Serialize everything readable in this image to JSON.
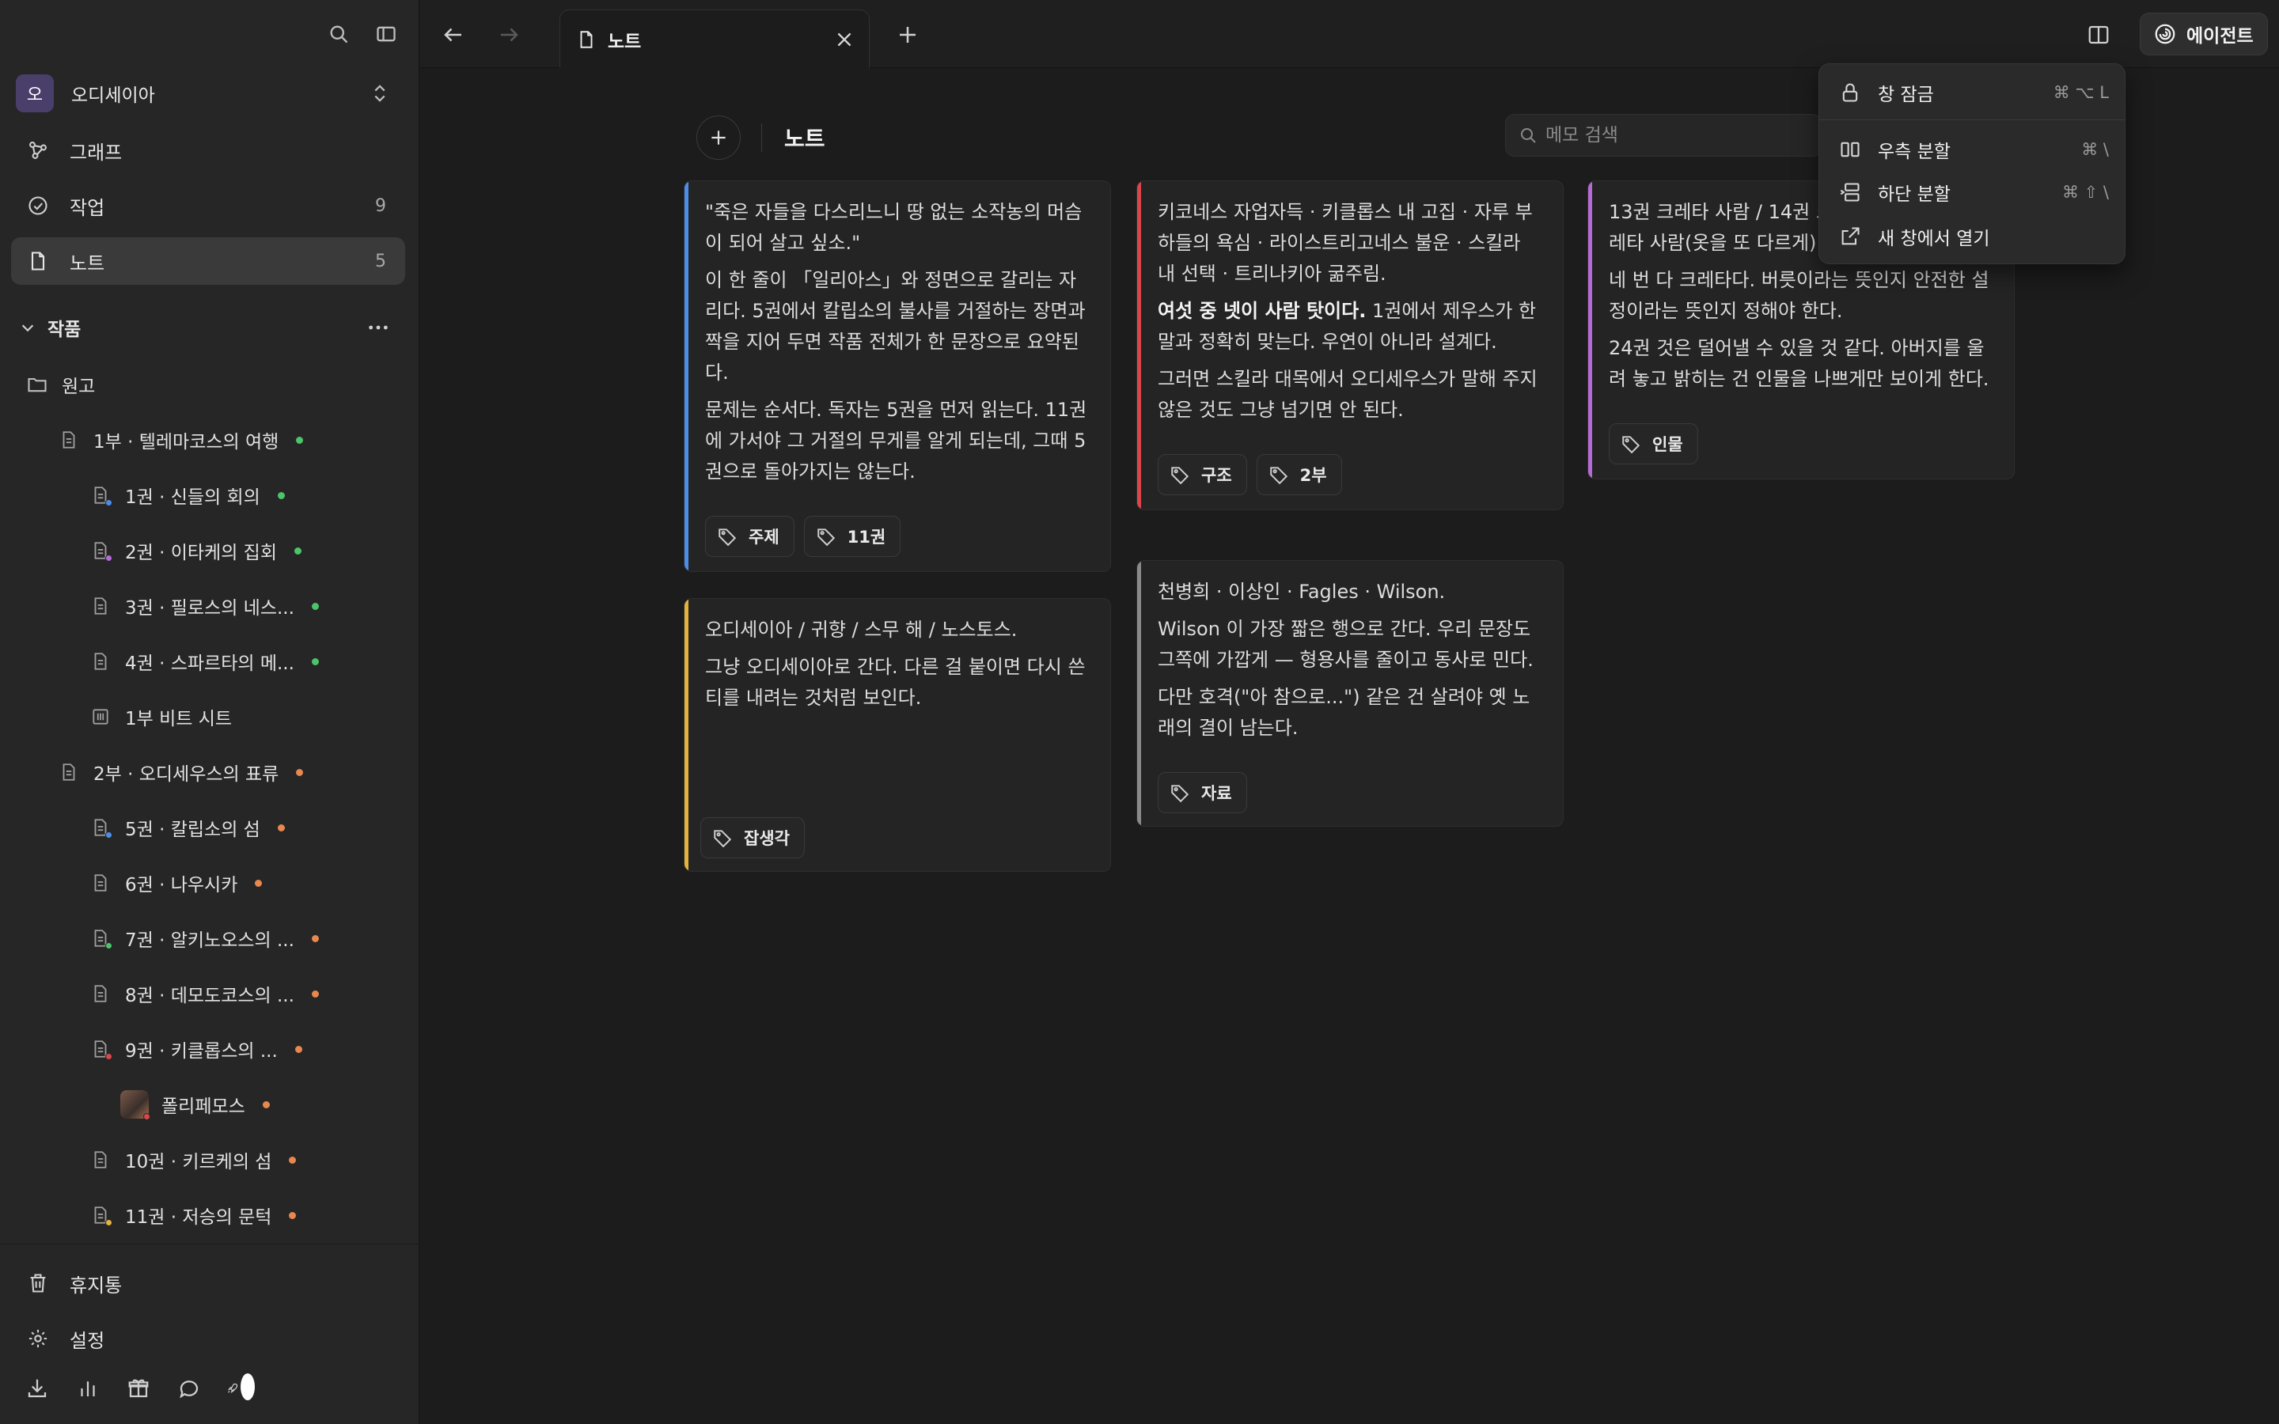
{
  "sidebar": {
    "workspace": {
      "avatar_letter": "오",
      "name": "오디세이아"
    },
    "nav": [
      {
        "label": "그래프",
        "count": ""
      },
      {
        "label": "작업",
        "count": "9"
      },
      {
        "label": "노트",
        "count": "5"
      }
    ],
    "section": {
      "label": "작품"
    },
    "tree": [
      {
        "label": "원고"
      },
      {
        "label": "1부 · 텔레마코스의 여행"
      },
      {
        "label": "1권 · 신들의 회의"
      },
      {
        "label": "2권 · 이타케의 집회"
      },
      {
        "label": "3권 · 필로스의 네스..."
      },
      {
        "label": "4권 · 스파르타의 메..."
      },
      {
        "label": "1부 비트 시트"
      },
      {
        "label": "2부 · 오디세우스의 표류"
      },
      {
        "label": "5권 · 칼립소의 섬"
      },
      {
        "label": "6권 · 나우시카"
      },
      {
        "label": "7권 · 알키노오스의 ..."
      },
      {
        "label": "8권 · 데모도코스의 ..."
      },
      {
        "label": "9권 · 키클롭스의 ..."
      },
      {
        "label": "폴리페모스"
      },
      {
        "label": "10권 · 키르케의 섬"
      },
      {
        "label": "11권 · 저승의 문턱"
      }
    ],
    "bottom": [
      {
        "label": "휴지통"
      },
      {
        "label": "설정"
      }
    ],
    "colors": {
      "green": "#4cc46a",
      "orange": "#e8874e",
      "blue": "#4c8de8",
      "purple": "#b56ad6",
      "red": "#d9464b",
      "yellow": "#e3b33d"
    }
  },
  "topbar": {
    "tab_label": "노트",
    "agent_label": "에이전트"
  },
  "main": {
    "title": "노트",
    "search_placeholder": "메모 검색",
    "cards": [
      {
        "accent": "#4c8de8",
        "paragraphs": [
          "\"죽은 자들을 다스리느니 땅 없는 소작농의 머슴이 되어 살고 싶소.\"",
          "이 한 줄이 「일리아스」와 정면으로 갈리는 자리다. 5권에서 칼립소의 불사를 거절하는 장면과 짝을 지어 두면 작품 전체가 한 문장으로 요약된다.",
          "문제는 순서다. 독자는 5권을 먼저 읽는다. 11권에 가서야 그 거절의 무게를 알게 되는데, 그때 5권으로 돌아가지는 않는다."
        ],
        "tags": [
          "주제",
          "11권"
        ]
      },
      {
        "accent": "#e3b33d",
        "paragraphs": [
          "오디세이아 / 귀향 / 스무 해 / 노스토스.",
          "그냥 오디세이아로 간다. 다른 걸 붙이면 다시 쓴 티를 내려는 것처럼 보인다."
        ],
        "tags": [
          "잡생각"
        ]
      },
      {
        "accent": "#d9464b",
        "paragraphs": [
          "키코네스 자업자득 · 키클롭스 내 고집 · 자루 부하들의 욕심 · 라이스트리고네스 불운 · 스킬라 내 선택 · 트리나키아 굶주림."
        ],
        "bold_lead": "여섯 중 넷이 사람 탓이다.",
        "bold_rest": " 1권에서 제우스가 한 말과 정확히 맞는다. 우연이 아니라 설계다.",
        "paragraphs_after": [
          "그러면 스킬라 대목에서 오디세우스가 말해 주지 않은 것도 그냥 넘기면 안 된다."
        ],
        "tags": [
          "구조",
          "2부"
        ]
      },
      {
        "accent": "#8a8a8a",
        "paragraphs": [
          "천병희 · 이상인 · Fagles · Wilson.",
          "Wilson 이 가장 짧은 행으로 간다. 우리 문장도 그쪽에 가깝게 — 형용사를 줄이고 동사로 민다.",
          "다만 호격(\"아 참으로...\") 같은 건 살려야 옛 노래의 결이 남는다."
        ],
        "tags": [
          "자료"
        ]
      },
      {
        "accent": "#b56ad6",
        "paragraphs": [
          "13권 크레타 사람 / 14권 크레타 사람 / 19권 크레타 사람(옷을 또 다르게) 앞에서.",
          "네 번 다 크레타다. 버릇이라는 뜻인지 안전한 설정이라는 뜻인지 정해야 한다.",
          "24권 것은 덜어낼 수 있을 것 같다. 아버지를 울려 놓고 밝히는 건 인물을 나쁘게만 보이게 한다."
        ],
        "tags": [
          "인물"
        ]
      }
    ]
  },
  "menu": {
    "items": [
      {
        "label": "창 잠금",
        "shortcut": "⌘ ⌥ L"
      },
      {
        "label": "우측 분할",
        "shortcut": "⌘ \\"
      },
      {
        "label": "하단 분할",
        "shortcut": "⌘ ⇧ \\"
      },
      {
        "label": "새 창에서 열기",
        "shortcut": ""
      }
    ]
  }
}
